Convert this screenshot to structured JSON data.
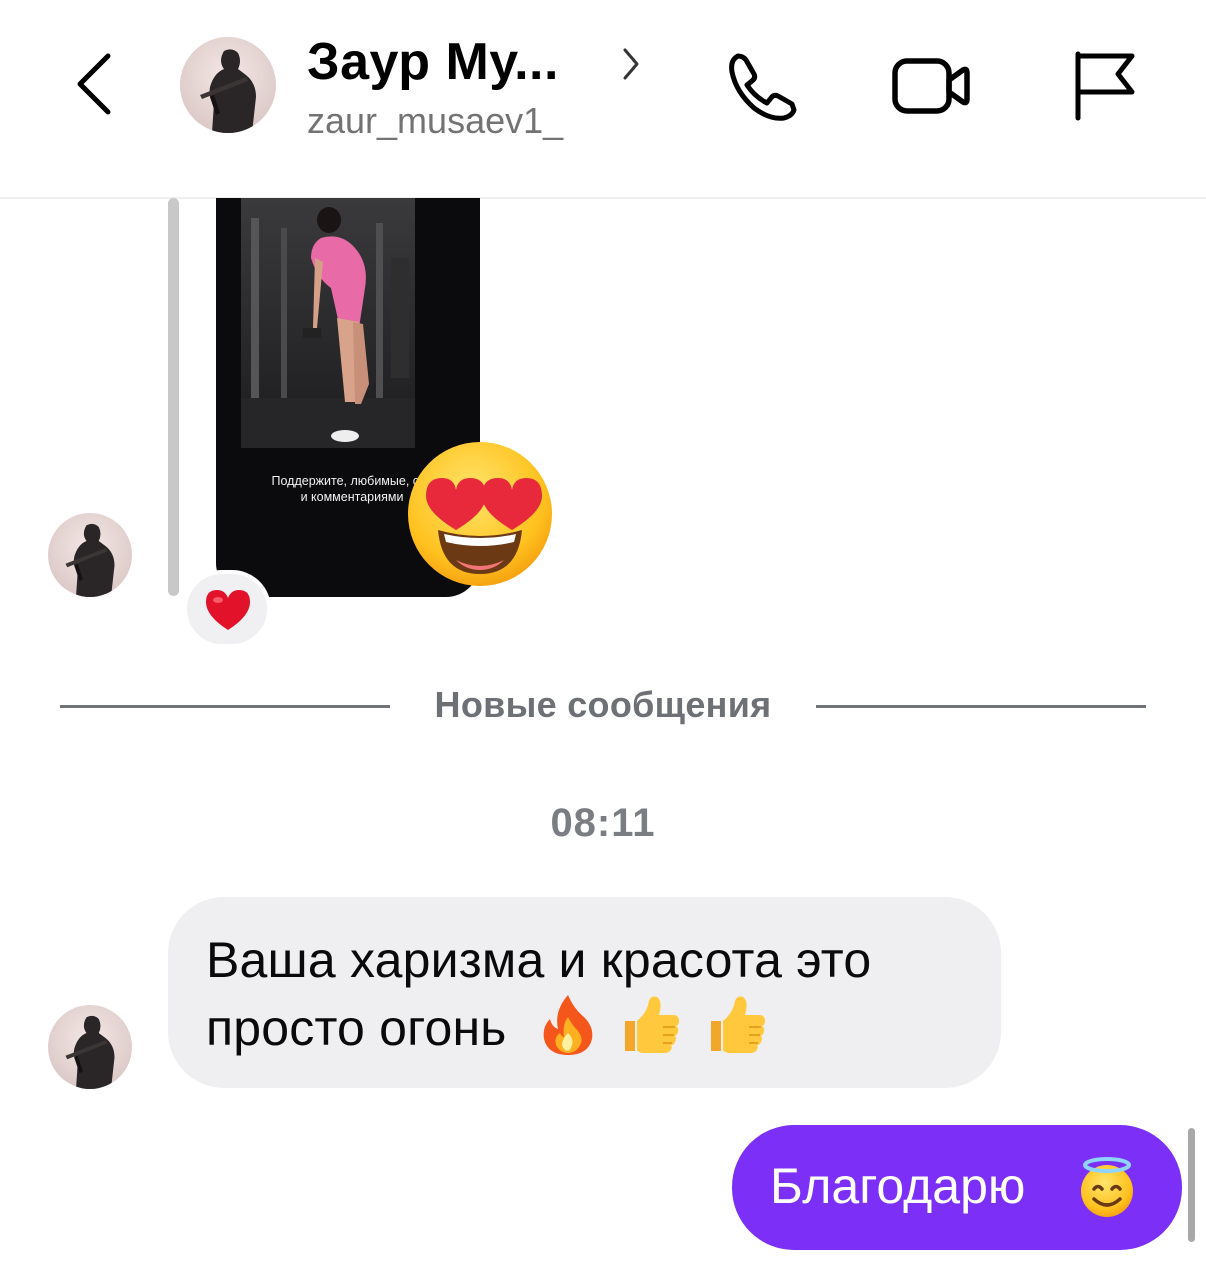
{
  "header": {
    "contact_name": "Заур Му...",
    "username": "zaur_musaev1_",
    "icons": {
      "back": "chevron-left-icon",
      "call": "phone-icon",
      "video": "video-camera-icon",
      "report": "flag-icon"
    }
  },
  "story_reply": {
    "caption_line1": "Поддержите, любимые, сво",
    "caption_line2": "и комментариями",
    "reaction_emoji": "smiling-face-with-heart-eyes",
    "message_reaction": "red-heart"
  },
  "divider": {
    "label": "Новые сообщения"
  },
  "timestamp": "08:11",
  "messages": [
    {
      "direction": "incoming",
      "line1": "Ваша харизма и красота это",
      "line2": "просто огонь",
      "emojis": [
        "fire",
        "thumbs-up",
        "thumbs-up"
      ]
    },
    {
      "direction": "outgoing",
      "text": "Благодарю",
      "emoji": "smiling-face-with-halo"
    }
  ],
  "colors": {
    "outgoing_bubble": "#7b2ff7",
    "incoming_bubble": "#efeff1",
    "secondary_text": "#737373"
  }
}
